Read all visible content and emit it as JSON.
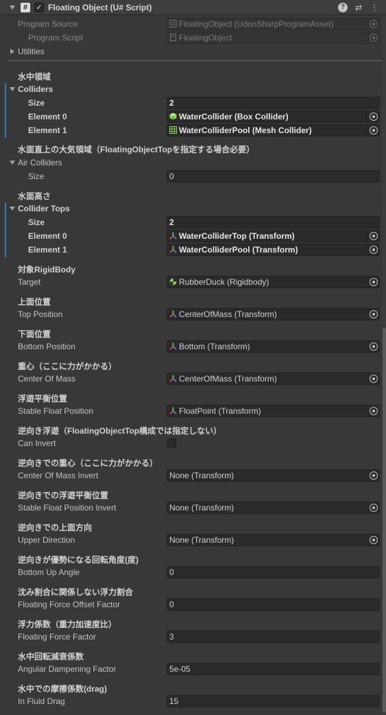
{
  "header": {
    "title": "Floating Object (U# Script)",
    "script_icon": "#",
    "enabled_check": "✓",
    "help_icon": "?",
    "settings_icon": "⇄",
    "menu_icon": "⋮"
  },
  "program": {
    "source_label": "Program Source",
    "source_value": "FloatingObject (UdonSharpProgramAsset)",
    "script_label": "Program Script",
    "script_value": "FloatingObject"
  },
  "utilities_label": "Utilities",
  "colliders": {
    "section": "水中領域",
    "label": "Colliders",
    "size_label": "Size",
    "size_value": "2",
    "el0_label": "Element 0",
    "el0_value": "WaterCollider (Box Collider)",
    "el1_label": "Element 1",
    "el1_value": "WaterColliderPool (Mesh Collider)"
  },
  "air": {
    "section": "水面直上の大気領域（FloatingObjectTopを指定する場合必要）",
    "label": "Air Colliders",
    "size_label": "Size",
    "size_value": "0"
  },
  "tops": {
    "section": "水面高さ",
    "label": "Collider Tops",
    "size_label": "Size",
    "size_value": "2",
    "el0_label": "Element 0",
    "el0_value": "WaterColliderTop (Transform)",
    "el1_label": "Element 1",
    "el1_value": "WaterColliderPool (Transform)"
  },
  "props": {
    "target_section": "対象RigidBody",
    "target_label": "Target",
    "target_value": "RubberDuck (Rigidbody)",
    "top_section": "上面位置",
    "top_label": "Top Position",
    "top_value": "CenterOfMass (Transform)",
    "bottom_section": "下面位置",
    "bottom_label": "Bottom Position",
    "bottom_value": "Bottom (Transform)",
    "com_section": "重心（ここに力がかかる）",
    "com_label": "Center Of Mass",
    "com_value": "CenterOfMass (Transform)",
    "stable_section": "浮遊平衡位置",
    "stable_label": "Stable Float Position",
    "stable_value": "FloatPoint (Transform)",
    "invert_section": "逆向き浮遊（FloatingObjectTop構成では指定しない）",
    "invert_label": "Can Invert",
    "comi_section": "逆向きでの重心（ここに力がかかる）",
    "comi_label": "Center Of Mass Invert",
    "comi_value": "None (Transform)",
    "sfi_section": "逆向きでの浮遊平衡位置",
    "sfi_label": "Stable Float Position Invert",
    "sfi_value": "None (Transform)",
    "up_section": "逆向きでの上面方向",
    "up_label": "Upper Direction",
    "up_value": "None (Transform)",
    "angle_section": "逆向きが優勢になる回転角度(度)",
    "angle_label": "Bottom Up Angle",
    "angle_value": "0",
    "offset_section": "沈み割合に関係しない浮力割合",
    "offset_label": "Floating Force Offset Factor",
    "offset_value": "0",
    "force_section": "浮力係数（重力加速度比）",
    "force_label": "Floating Force Factor",
    "force_value": "3",
    "damp_section": "水中回転減衰係数",
    "damp_label": "Angular Dampening Factor",
    "damp_value": "5e-05",
    "drag_section": "水中での摩擦係数(drag)",
    "drag_label": "In Fluid Drag",
    "drag_value": "15"
  },
  "colors": {
    "accent_bar": "#3b77b8",
    "background": "#383838",
    "field_bg": "#2a2a2a"
  }
}
